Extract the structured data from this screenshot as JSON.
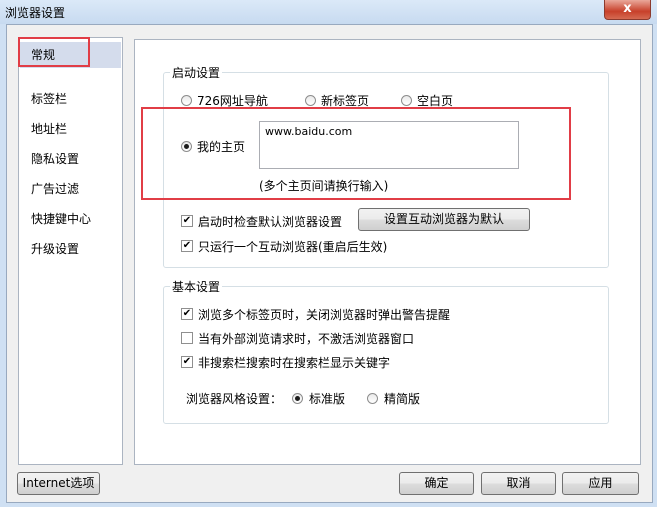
{
  "window": {
    "title": "浏览器设置",
    "close_glyph": "x"
  },
  "sidebar": {
    "items": [
      {
        "label": "常规"
      },
      {
        "label": "标签栏"
      },
      {
        "label": "地址栏"
      },
      {
        "label": "隐私设置"
      },
      {
        "label": "广告过滤"
      },
      {
        "label": "快捷键中心"
      },
      {
        "label": "升级设置"
      }
    ],
    "active_index": 0
  },
  "startup": {
    "title": "启动设置",
    "options": [
      {
        "label": "726网址导航",
        "checked": false
      },
      {
        "label": "新标签页",
        "checked": false
      },
      {
        "label": "空白页",
        "checked": false
      },
      {
        "label": "我的主页",
        "checked": true
      }
    ],
    "homepage_value": "www.baidu.com",
    "hint": "(多个主页间请换行输入)",
    "check_default_label": "启动时检查默认浏览器设置",
    "set_default_button": "设置互动浏览器为默认",
    "single_instance_label": "只运行一个互动浏览器(重启后生效)"
  },
  "basic": {
    "title": "基本设置",
    "warn_close_label": "浏览多个标签页时，关闭浏览器时弹出警告提醒",
    "no_activate_label": "当有外部浏览请求时，不激活浏览器窗口",
    "show_keyword_label": "非搜索栏搜索时在搜索栏显示关键字",
    "style_label": "浏览器风格设置：",
    "style_options": [
      {
        "label": "标准版",
        "checked": true
      },
      {
        "label": "精简版",
        "checked": false
      }
    ]
  },
  "footer": {
    "internet_options": "Internet选项",
    "ok": "确定",
    "cancel": "取消",
    "apply": "应用"
  },
  "colors": {
    "highlight": "#e13d46",
    "active_item": "#d4dcec"
  }
}
